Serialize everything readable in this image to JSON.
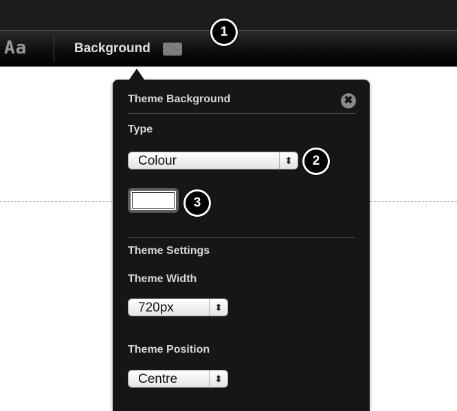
{
  "toolbar": {
    "font_label": "Aa",
    "background_label": "Background"
  },
  "panel": {
    "title": "Theme Background",
    "close_glyph": "✖",
    "type_label": "Type",
    "type_value": "Colour",
    "color_value": "#ffffff",
    "settings_heading": "Theme Settings",
    "width_label": "Theme Width",
    "width_value": "720px",
    "position_label": "Theme Position",
    "position_value": "Centre"
  },
  "callouts": [
    "1",
    "2",
    "3"
  ],
  "icons": {
    "select_arrows": "⬍",
    "swatch": "background-swatch-icon",
    "close": "close-icon"
  }
}
